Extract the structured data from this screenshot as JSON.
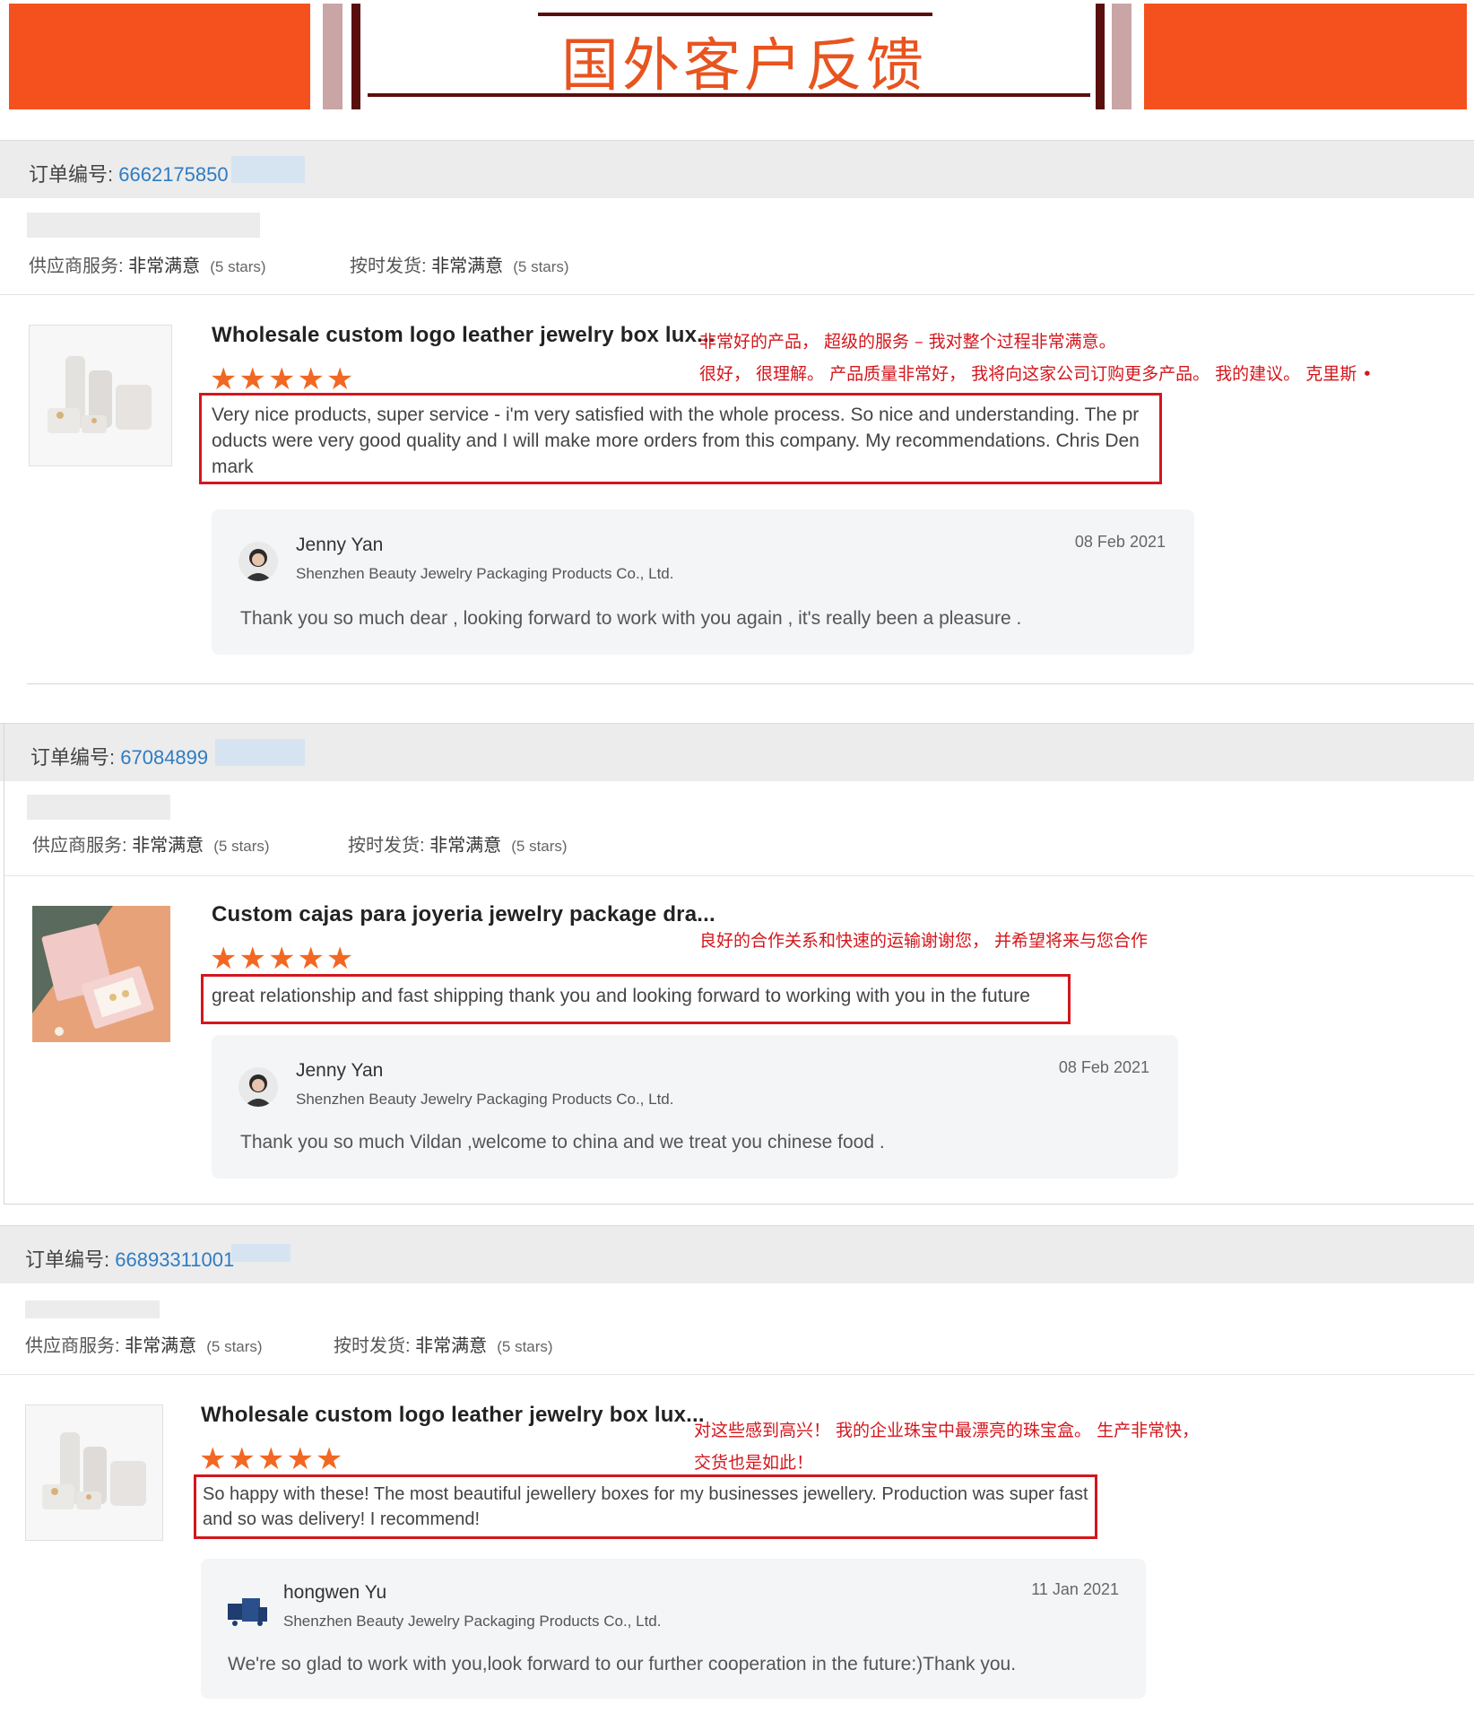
{
  "banner": {
    "title": "国外客户反馈",
    "accent_color": "#f4511e",
    "title_color": "#e8541f"
  },
  "labels": {
    "order_prefix": "订单编号:",
    "supplier_service": "供应商服务:",
    "on_time_delivery": "按时发货:",
    "very_satisfied": "非常满意",
    "five_stars": "(5 stars)",
    "stars": "★★★★★"
  },
  "reviews": [
    {
      "order_number": "6662175850",
      "product_title": "Wholesale custom logo leather jewelry box lux...",
      "product_icon": "white-jewelry-box-image",
      "review_text": "Very nice products, super service - i'm very satisfied with the whole process. So nice and understanding. The products were very good quality and I will make more orders from this company. My recommendations. Chris Denmark",
      "translation": [
        "非常好的产品，   超级的服务 – 我对整个过程非常满意。",
        "很好，   很理解。   产品质量非常好，   我将向这家公司订购更多产品。   我的建议。   克里斯 •"
      ],
      "reply": {
        "name": "Jenny Yan",
        "company": "Shenzhen Beauty Jewelry Packaging Products Co., Ltd.",
        "date": "08 Feb 2021",
        "message": "Thank you so much dear , looking forward to work with you again , it's really been a pleasure ."
      }
    },
    {
      "order_number": "67084899",
      "product_title": "Custom cajas para joyeria jewelry package dra...",
      "product_icon": "pink-jewelry-box-image",
      "review_text": "great relationship and fast shipping thank you and looking forward to working with you in the future",
      "translation": [
        "良好的合作关系和快速的运输谢谢您，   并希望将来与您合作"
      ],
      "reply": {
        "name": "Jenny Yan",
        "company": "Shenzhen Beauty Jewelry Packaging Products Co., Ltd.",
        "date": "08 Feb 2021",
        "message": "Thank you so much Vildan ,welcome to china and we treat you chinese food ."
      }
    },
    {
      "order_number": "66893311001",
      "product_title": "Wholesale custom logo leather jewelry box lux...",
      "product_icon": "white-jewelry-box-image",
      "review_text": "So happy with these! The most beautiful jewellery boxes for my businesses jewellery. Production was super fast and so was delivery! I recommend!",
      "translation": [
        "对这些感到高兴！   我的企业珠宝中最漂亮的珠宝盒。   生产非常快，",
        "交货也是如此！"
      ],
      "reply": {
        "name": "hongwen Yu",
        "company": "Shenzhen Beauty Jewelry Packaging Products Co., Ltd.",
        "date": "11 Jan 2021",
        "message": "We're so glad to work with you,look forward to our further cooperation in the future:)Thank you."
      }
    }
  ]
}
